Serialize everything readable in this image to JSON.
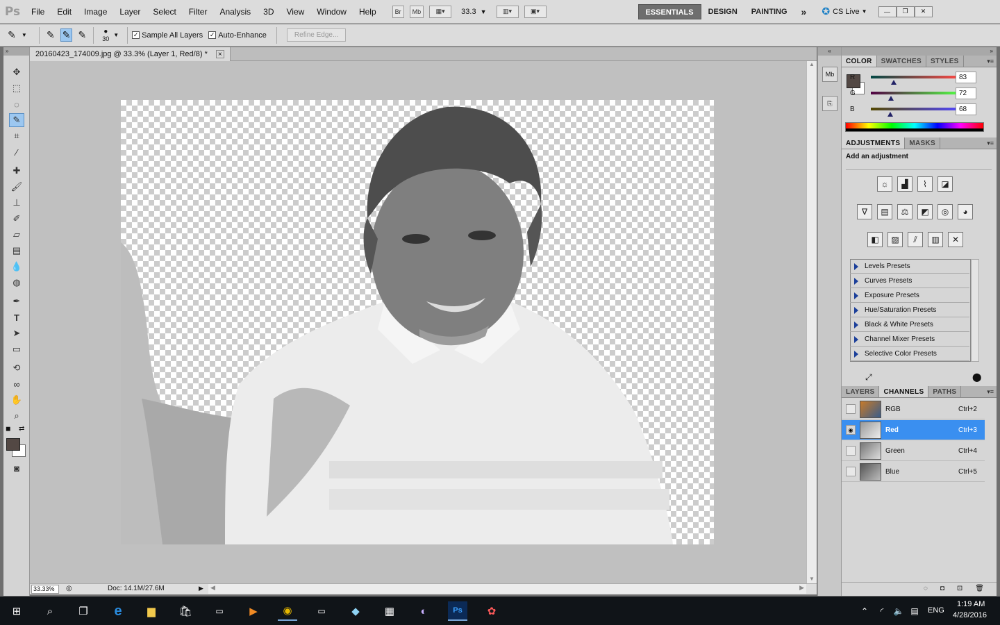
{
  "app": {
    "logo": "Ps"
  },
  "menus": [
    "File",
    "Edit",
    "Image",
    "Layer",
    "Select",
    "Filter",
    "Analysis",
    "3D",
    "View",
    "Window",
    "Help"
  ],
  "menubar_buttons": {
    "bridge": "Br",
    "minibridge": "Mb",
    "zoom": "33.3"
  },
  "workspaces": {
    "active": "ESSENTIALS",
    "design": "DESIGN",
    "painting": "PAINTING",
    "more": "»",
    "cslive": "CS Live"
  },
  "options": {
    "brush_size": "30",
    "sample_all_layers": "Sample All Layers",
    "auto_enhance": "Auto-Enhance",
    "refine_edge": "Refine Edge..."
  },
  "document": {
    "tab_title": "20160423_174009.jpg @ 33.3% (Layer 1, Red/8) *",
    "close": "×"
  },
  "status": {
    "zoom": "33.33%",
    "doc": "Doc: 14.1M/27.6M"
  },
  "color_panel": {
    "tabs": [
      "COLOR",
      "SWATCHES",
      "STYLES"
    ],
    "foreground": "#534844",
    "sliders": [
      {
        "label": "R",
        "value": "83"
      },
      {
        "label": "G",
        "value": "72"
      },
      {
        "label": "B",
        "value": "68"
      }
    ]
  },
  "adjustments_panel": {
    "tabs": [
      "ADJUSTMENTS",
      "MASKS"
    ],
    "heading": "Add an adjustment",
    "presets": [
      "Levels Presets",
      "Curves Presets",
      "Exposure Presets",
      "Hue/Saturation Presets",
      "Black & White Presets",
      "Channel Mixer Presets",
      "Selective Color Presets"
    ]
  },
  "channels_panel": {
    "tabs": [
      "LAYERS",
      "CHANNELS",
      "PATHS"
    ],
    "channels": [
      {
        "name": "RGB",
        "shortcut": "Ctrl+2"
      },
      {
        "name": "Red",
        "shortcut": "Ctrl+3"
      },
      {
        "name": "Green",
        "shortcut": "Ctrl+4"
      },
      {
        "name": "Blue",
        "shortcut": "Ctrl+5"
      }
    ]
  },
  "taskbar": {
    "time": "1:19 AM",
    "date": "4/28/2016",
    "lang": "ENG"
  }
}
